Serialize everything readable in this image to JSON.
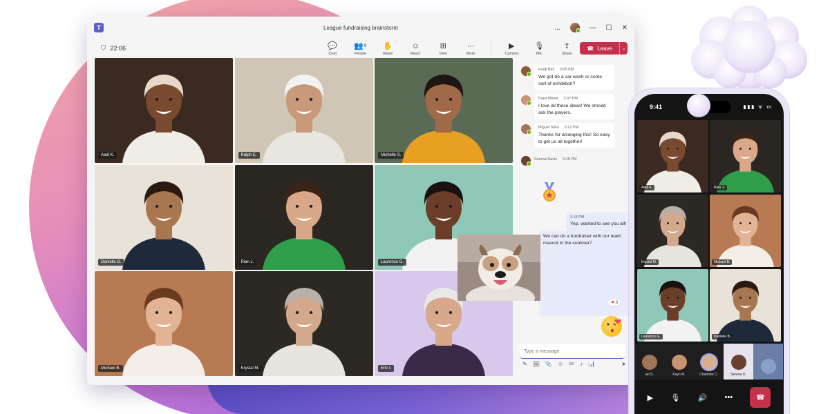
{
  "window": {
    "title": "League fundraising brainstorm",
    "controls": [
      "...",
      "—",
      "☐",
      "✕"
    ]
  },
  "toolbar": {
    "timer": "22:06",
    "tools": [
      {
        "label": "Chat",
        "icon": "chat-icon",
        "glyph": "💬"
      },
      {
        "label": "People",
        "icon": "people-icon",
        "glyph": "👥",
        "count": "9"
      },
      {
        "label": "Raise",
        "icon": "raise-hand-icon",
        "glyph": "✋"
      },
      {
        "label": "React",
        "icon": "react-icon",
        "glyph": "☺"
      },
      {
        "label": "View",
        "icon": "view-icon",
        "glyph": "⊞"
      },
      {
        "label": "More",
        "icon": "more-icon",
        "glyph": "···"
      },
      {
        "label": "Camera",
        "icon": "camera-icon",
        "glyph": "▶"
      },
      {
        "label": "Mic",
        "icon": "mic-icon",
        "glyph": "🎙"
      },
      {
        "label": "Share",
        "icon": "share-icon",
        "glyph": "⇪"
      }
    ],
    "leave_label": "Leave"
  },
  "participants": [
    {
      "name": "Aadi K.",
      "bg": "#3a2a22",
      "skin": "#7a4a30",
      "hair": "#e8d8c8",
      "shirt": "#f0ece6"
    },
    {
      "name": "Ralph E.",
      "bg": "#cfc6b6",
      "skin": "#c89a7a",
      "hair": "#f2f2f2",
      "shirt": "#e8e6e0"
    },
    {
      "name": "Michelle S.",
      "bg": "#5a6b55",
      "skin": "#a06a48",
      "hair": "#1e1612",
      "shirt": "#e8a022"
    },
    {
      "name": "Danielle B.",
      "bg": "#e8e2d8",
      "skin": "#a8764f",
      "hair": "#2a1a12",
      "shirt": "#1e2a3a"
    },
    {
      "name": "Rian J.",
      "bg": "#2a2622",
      "skin": "#d9a888",
      "hair": "#3a2418",
      "shirt": "#2e9e4a"
    },
    {
      "name": "Laurence G.",
      "bg": "#8fc8b8",
      "skin": "#6a3e28",
      "hair": "#1a1210",
      "shirt": "#f2f2f2"
    },
    {
      "name": "Michael B.",
      "bg": "#b87a52",
      "skin": "#e2b394",
      "hair": "#6a3a20",
      "shirt": "#f4eee8"
    },
    {
      "name": "Krystal M.",
      "bg": "#2c2824",
      "skin": "#d4a88c",
      "hair": "#b8b0a8",
      "shirt": "#e8e4de"
    },
    {
      "name": "Eric I.",
      "bg": "#d8c8ec",
      "skin": "#d8a88a",
      "hair": "#e8e8e8",
      "shirt": "#3a2a4a"
    }
  ],
  "chat": {
    "messages": [
      {
        "author": "Kadji Bell",
        "time": "3:05 PM",
        "text": "We got do a car wash or some sort of exhibition?",
        "avatar": "#8a5a3a"
      },
      {
        "author": "Kayo Miwat",
        "time": "3:07 PM",
        "text": "I love all these ideas! We should ask the players.",
        "avatar": "#c99270"
      },
      {
        "author": "Miguel Silva",
        "time": "3:12 PM",
        "text": "Thanks for arranging this! So easy to get us all together!",
        "avatar": "#a0765a"
      },
      {
        "author": "Serena Davis",
        "time": "3:15 PM",
        "text": "",
        "avatar": "#6a4030"
      }
    ],
    "mine": [
      {
        "time": "3:15 PM",
        "text": "Yep, wanted to see you all!"
      },
      {
        "time": "",
        "text": "We can do a fundraiser with our team mascot in the summer?"
      }
    ],
    "reaction_count": "3",
    "compose_placeholder": "Type a message",
    "compose_tools": [
      "✎",
      "🖼",
      "📎",
      "☺",
      "GIF",
      "♪",
      "📊"
    ]
  },
  "phone": {
    "time": "9:41",
    "status_icons": "▮▮▮ ᯤ ▭",
    "tiles": [
      {
        "name": "Aadi K.",
        "bg": "#3a2a22",
        "skin": "#7a4a30",
        "hair": "#e8d8c8",
        "shirt": "#f0ece6"
      },
      {
        "name": "Rian J.",
        "bg": "#2a2622",
        "skin": "#d9a888",
        "hair": "#3a2418",
        "shirt": "#2e9e4a"
      },
      {
        "name": "Krystal M.",
        "bg": "#2c2824",
        "skin": "#d4a88c",
        "hair": "#b8b0a8",
        "shirt": "#e8e4de"
      },
      {
        "name": "Michael B.",
        "bg": "#b87a52",
        "skin": "#e2b394",
        "hair": "#6a3a20",
        "shirt": "#f4eee8"
      },
      {
        "name": "Laurence G.",
        "bg": "#8fc8b8",
        "skin": "#6a3e28",
        "hair": "#1a1210",
        "shirt": "#f2f2f2"
      },
      {
        "name": "Danielle B.",
        "bg": "#e8e2d8",
        "skin": "#a8764f",
        "hair": "#2a1a12",
        "shirt": "#1e2a3a"
      }
    ],
    "strip": [
      {
        "name": "uel S.",
        "color": "#a0765a"
      },
      {
        "name": "Kayo M.",
        "color": "#c99270"
      },
      {
        "name": "Charlotte C.",
        "color": "#d8b090"
      },
      {
        "name": "Serena D.",
        "color": "#6a4030"
      },
      {
        "name": "",
        "color": "#8aa0c8"
      }
    ]
  },
  "colors": {
    "accent": "#5b5fc7",
    "leave": "#c4314b",
    "presence": "#6bb700"
  }
}
